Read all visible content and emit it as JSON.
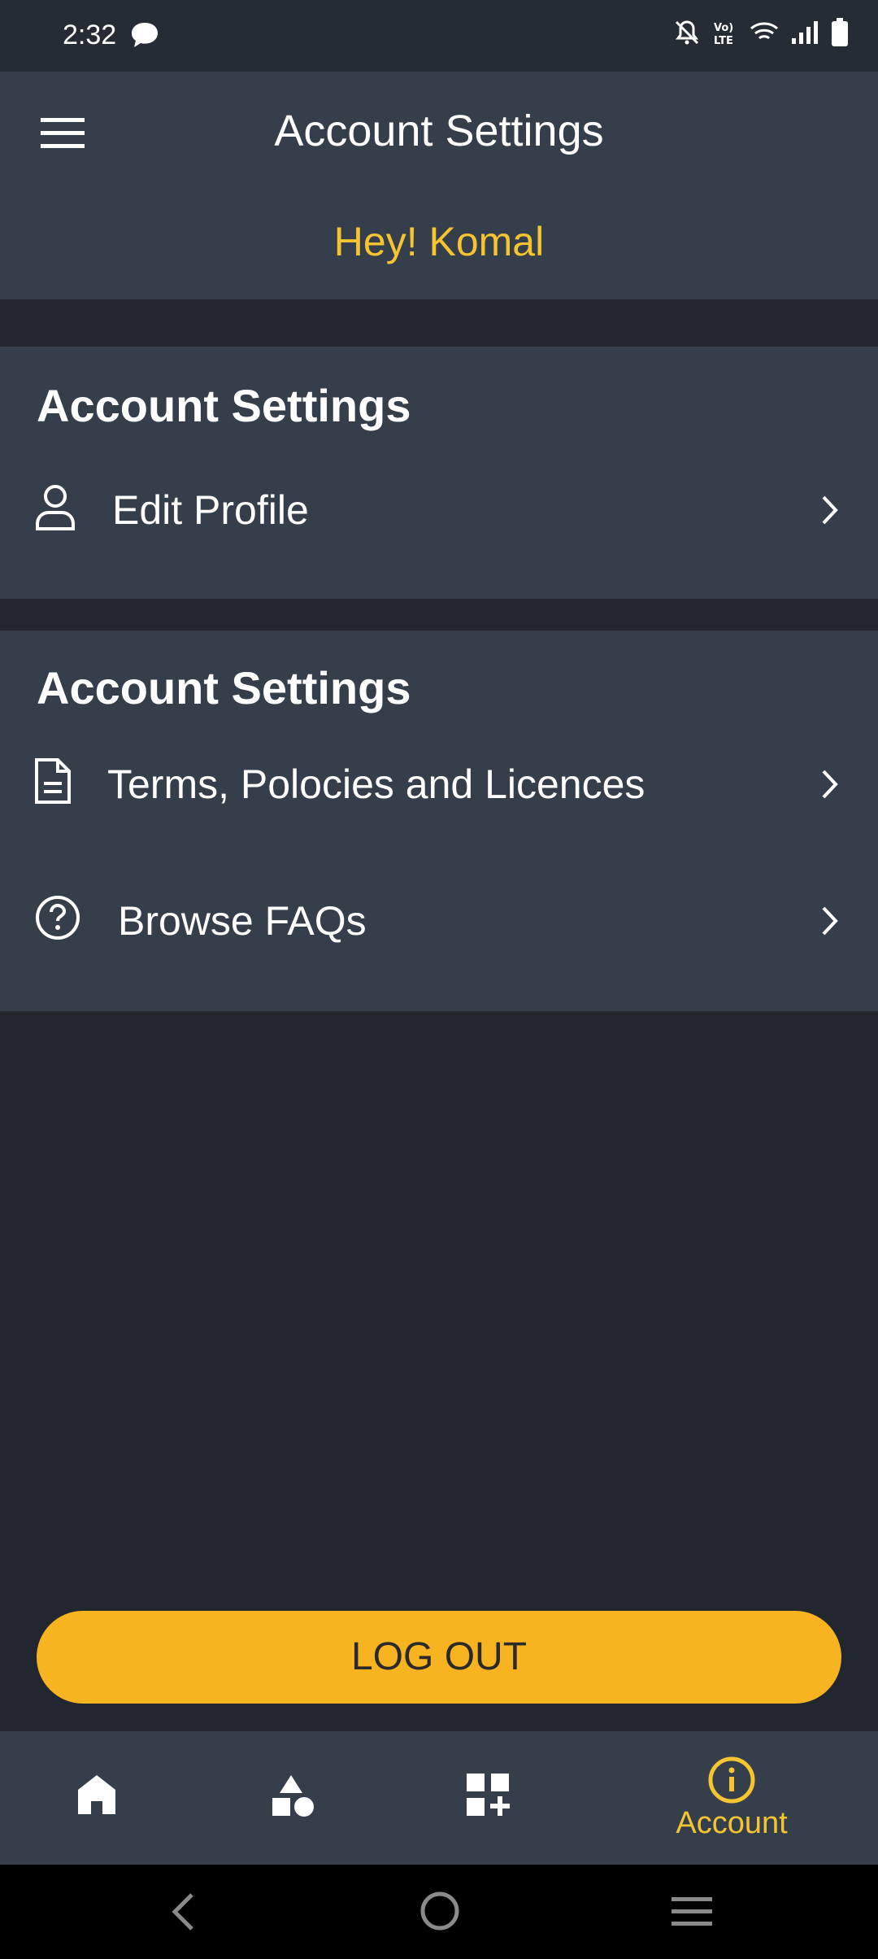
{
  "status_bar": {
    "time": "2:32",
    "icons": [
      "message-icon",
      "mute-icon",
      "volte-icon",
      "wifi-icon",
      "signal-icon",
      "battery-icon"
    ]
  },
  "header": {
    "title": "Account Settings",
    "greeting": "Hey! Komal"
  },
  "sections": [
    {
      "heading": "Account Settings",
      "items": [
        {
          "label": "Edit Profile",
          "icon": "person-icon"
        }
      ]
    },
    {
      "heading": "Account Settings",
      "items": [
        {
          "label": "Terms, Polocies and Licences",
          "icon": "document-icon"
        },
        {
          "label": "Browse FAQs",
          "icon": "question-icon"
        }
      ]
    }
  ],
  "logout_label": "LOG OUT",
  "bottom_nav": {
    "items": [
      {
        "icon": "home-icon",
        "label": ""
      },
      {
        "icon": "shapes-icon",
        "label": ""
      },
      {
        "icon": "grid-add-icon",
        "label": ""
      },
      {
        "icon": "info-icon",
        "label": "Account",
        "active": true
      }
    ]
  },
  "colors": {
    "accent": "#f6c430",
    "button": "#f8b320",
    "surface": "#353e4b",
    "background": "#22272f"
  }
}
